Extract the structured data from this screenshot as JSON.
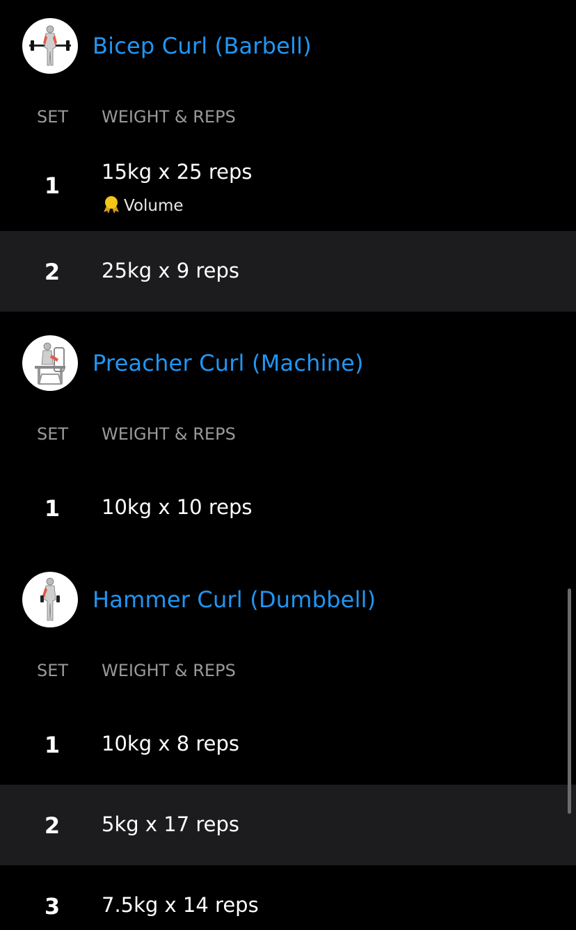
{
  "colors": {
    "background": "#000000",
    "title": "#2196f3",
    "header_text": "#9a9a9a",
    "row_alt": "#1c1c1e",
    "medal": "#f5c518"
  },
  "columns": {
    "set": "SET",
    "weight_reps": "WEIGHT & REPS"
  },
  "exercises": [
    {
      "title": "Bicep Curl (Barbell)",
      "icon": "bicep-curl-barbell-icon",
      "sets": [
        {
          "set": "1",
          "value": "15kg x 25 reps",
          "pr": "Volume",
          "pr_icon": "medal-icon"
        },
        {
          "set": "2",
          "value": "25kg x 9 reps"
        }
      ]
    },
    {
      "title": "Preacher Curl (Machine)",
      "icon": "preacher-curl-machine-icon",
      "sets": [
        {
          "set": "1",
          "value": "10kg x 10 reps"
        }
      ]
    },
    {
      "title": "Hammer Curl (Dumbbell)",
      "icon": "hammer-curl-dumbbell-icon",
      "sets": [
        {
          "set": "1",
          "value": "10kg x 8 reps"
        },
        {
          "set": "2",
          "value": "5kg x 17 reps"
        },
        {
          "set": "3",
          "value": "7.5kg x 14 reps"
        }
      ]
    }
  ]
}
